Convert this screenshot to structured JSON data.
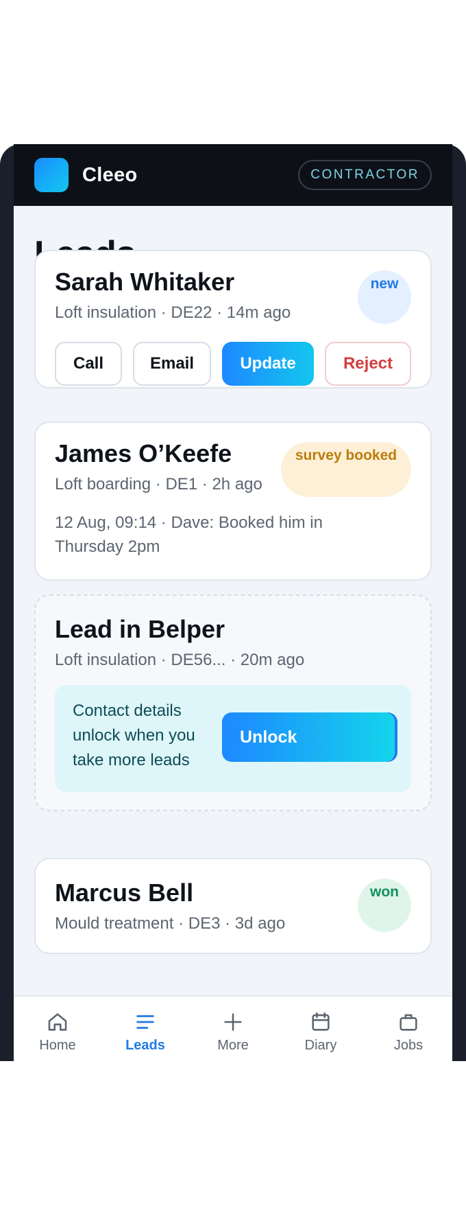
{
  "app": {
    "name": "Cleeo",
    "role": "CONTRACTOR"
  },
  "page": {
    "title": "Leads"
  },
  "leads": [
    {
      "name": "Sarah Whitaker",
      "meta": "Loft insulation · DE22 · 14m ago",
      "status": "new",
      "actions": {
        "call": "Call",
        "email": "Email",
        "update": "Update",
        "reject": "Reject"
      }
    },
    {
      "name": "James O’Keefe",
      "meta": "Loft boarding · DE1 · 2h ago",
      "status": "survey booked",
      "activity": "12 Aug, 09:14 · Dave: Booked him in Thursday 2pm"
    },
    {
      "name": "Lead in Belper",
      "meta": "Loft insulation · DE56... · 20m ago",
      "locked_message": "Contact details unlock when you take more leads",
      "unlock_label": "Unlock"
    },
    {
      "name": "Marcus Bell",
      "meta": "Mould treatment · DE3 · 3d ago",
      "status": "won"
    }
  ],
  "nav": [
    {
      "label": "Home",
      "icon": "home-icon",
      "active": false
    },
    {
      "label": "Leads",
      "icon": "list-icon",
      "active": true
    },
    {
      "label": "More",
      "icon": "plus-icon",
      "active": false
    },
    {
      "label": "Diary",
      "icon": "calendar-icon",
      "active": false
    },
    {
      "label": "Jobs",
      "icon": "briefcase-icon",
      "active": false
    }
  ],
  "colors": {
    "accent": "#2079e5",
    "header_bg": "#0d1117",
    "status_new": "#2079e5",
    "status_survey_booked": "#bc7d0c",
    "status_won": "#11905a",
    "reject": "#d23f3f"
  }
}
